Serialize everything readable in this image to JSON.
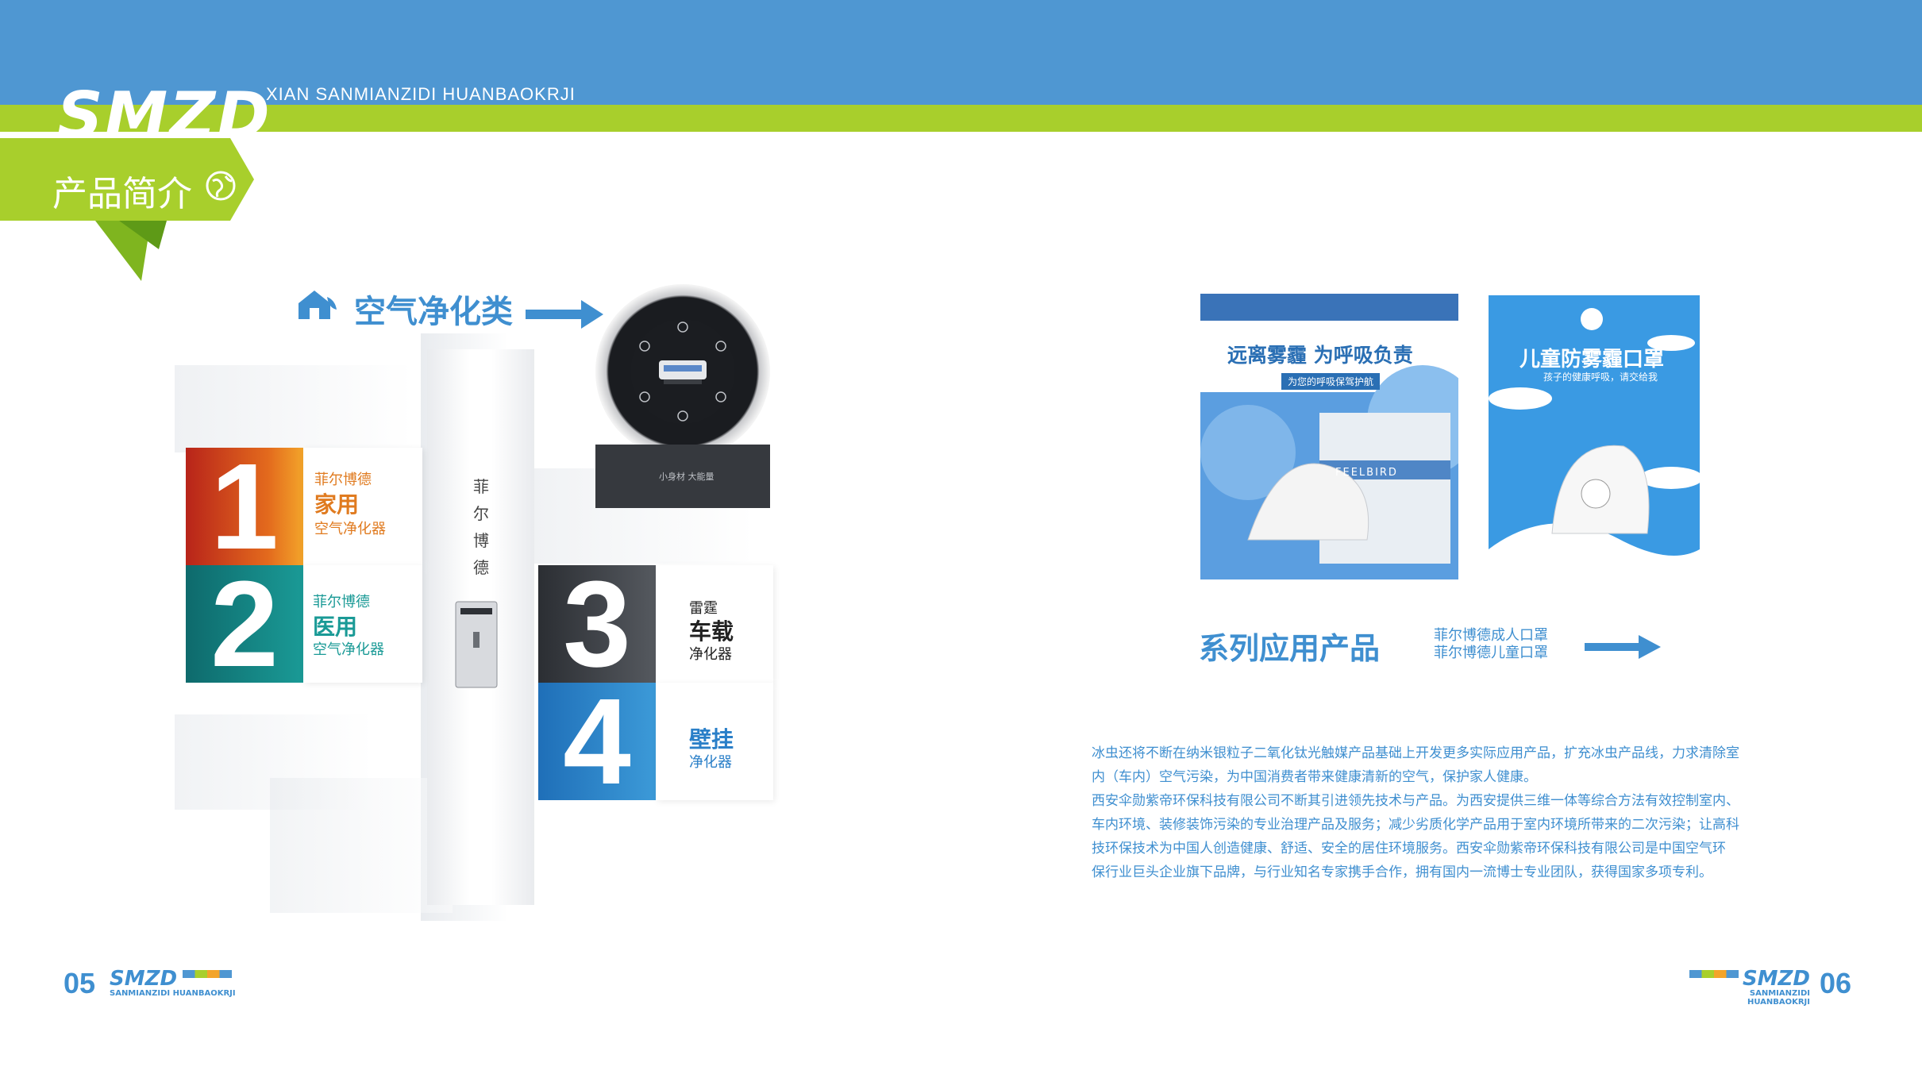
{
  "header": {
    "logo": "SMZD",
    "subtitle": "XIAN SANMIANZIDI HUANBAOKRJI",
    "section_tag": "产品简介"
  },
  "air_section": {
    "title": "空气净化类",
    "vertical_label": [
      "菲",
      "尔",
      "博",
      "德"
    ],
    "categories": [
      {
        "num": "1",
        "brand": "菲尔博德",
        "name": "家用",
        "type": "空气净化器"
      },
      {
        "num": "2",
        "brand": "菲尔博德",
        "name": "医用",
        "type": "空气净化器"
      },
      {
        "num": "3",
        "brand": "雷霆",
        "name": "车载",
        "type": "净化器"
      },
      {
        "num": "4",
        "brand": "",
        "name": "壁挂",
        "type": "净化器"
      }
    ],
    "device_caption": "小身材 大能量"
  },
  "mask_section": {
    "poster1_title": "远离雾霾 为呼吸负责",
    "poster1_sub": "为您的呼吸保驾护航",
    "poster1_brand": "FEELBIRD",
    "poster2_title": "儿童防雾霾口罩",
    "poster2_sub": "孩子的健康呼吸，请交给我",
    "series_title": "系列应用产品",
    "series_items": [
      "菲尔博德成人口罩",
      "菲尔博德儿童口罩"
    ]
  },
  "description": [
    "冰虫还将不断在纳米银粒子二氧化钛光触媒产品基础上开发更多实际应用产品，扩充冰虫产品线，力求清除室",
    "内（车内）空气污染，为中国消费者带来健康清新的空气，保护家人健康。",
    "西安伞勋紫帝环保科技有限公司不断其引进领先技术与产品。为西安提供三维一体等综合方法有效控制室内、",
    "车内环境、装修装饰污染的专业治理产品及服务；减少劣质化学产品用于室内环境所带来的二次污染；让高科",
    "技环保技术为中国人创造健康、舒适、安全的居住环境服务。西安伞勋紫帝环保科技有限公司是中国空气环",
    "保行业巨头企业旗下品牌，与行业知名专家携手合作，拥有国内一流博士专业团队，获得国家多项专利。"
  ],
  "footer": {
    "page_left": "05",
    "page_right": "06",
    "logo": "SMZD",
    "logo_sub": "SANMIANZIDI HUANBAOKRJI"
  },
  "colors": {
    "blue": "#4f97d2",
    "green": "#a8cf2c",
    "text_blue": "#3f8fd0",
    "orange": "#e07b20",
    "teal": "#1a9a96"
  }
}
